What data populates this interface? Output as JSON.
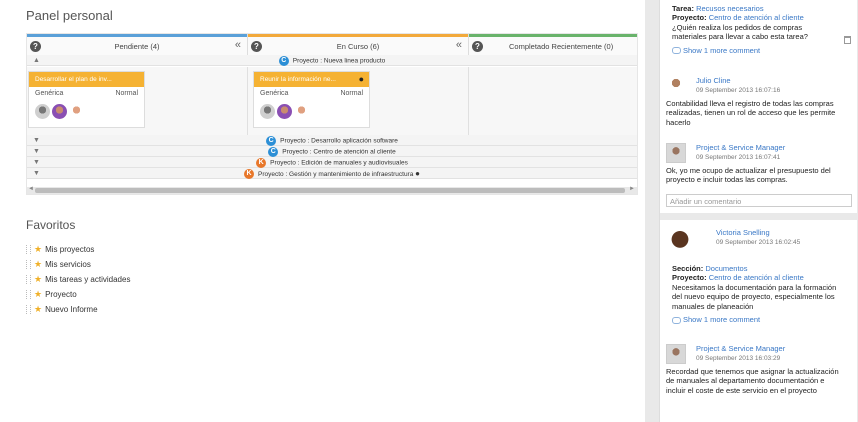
{
  "panel": {
    "title": "Panel personal"
  },
  "columns": [
    {
      "label": "Pendiente (4)",
      "color": "#5aa0d8",
      "collapse": "«"
    },
    {
      "label": "En Curso (6)",
      "color": "#f2a93b",
      "collapse": "«"
    },
    {
      "label": "Completado Recientemente (0)",
      "color": "#69b36b"
    }
  ],
  "lanes": [
    {
      "name": "Proyecto : Nueva linea producto",
      "badge": "C",
      "badge_color": "#2c8fd6",
      "expanded": true
    },
    {
      "name": "Proyecto : Desarrollo aplicación software",
      "badge": "C",
      "badge_color": "#2c8fd6"
    },
    {
      "name": "Proyecto : Centro de atención al cliente",
      "badge": "C",
      "badge_color": "#2c8fd6"
    },
    {
      "name": "Proyecto : Edición de manuales y audiovisuales",
      "badge": "K",
      "badge_color": "#e8772a"
    },
    {
      "name": "Proyecto : Gestión y mantenimiento de infraestructura",
      "badge": "K",
      "badge_color": "#e8772a"
    }
  ],
  "cards": [
    {
      "title": "Desarrollar el plan de inv...",
      "type": "Genérica",
      "priority": "Normal"
    },
    {
      "title": "Reunir la información ne...",
      "type": "Genérica",
      "priority": "Normal"
    }
  ],
  "favorites": {
    "title": "Favoritos",
    "items": [
      "Mis proyectos",
      "Mis servicios",
      "Mis tareas y actividades",
      "Proyecto",
      "Nuevo Informe"
    ]
  },
  "feed": {
    "top": {
      "tarea_label": "Tarea:",
      "tarea_value": "Recusos necesarios",
      "proyecto_label": "Proyecto:",
      "proyecto_value": "Centro de atención al cliente",
      "text": "¿Quién realiza los pedidos de compras materiales para llevar a cabo esta tarea?",
      "more": "Show 1 more comment"
    },
    "c1": {
      "user": "Julio Cline",
      "time": "09 September 2013 16:07:16",
      "text": "Contabilidad lleva el registro de todas las compras realizadas, tienen un rol de acceso que les permite hacerlo"
    },
    "c2": {
      "user": "Project & Service Manager",
      "time": "09 September 2013 16:07:41",
      "text": "Ok, yo me ocupo de actualizar el presupuesto del proyecto e incluir todas las compras."
    },
    "comment_placeholder": "Añadir un comentario",
    "post2": {
      "user": "Victoria Snelling",
      "time": "09 September 2013 16:02:45",
      "seccion_label": "Sección:",
      "seccion_value": "Documentos",
      "proyecto_label": "Proyecto:",
      "proyecto_value": "Centro de atención al cliente",
      "text": "Necesitamos la documentación para la formación del nuevo equipo de proyecto, especialmente los manuales de planeación",
      "more": "Show 1 more comment"
    },
    "c3": {
      "user": "Project & Service Manager",
      "time": "09 September 2013 16:03:29",
      "text": "Recordad que tenemos que asignar la actualización de manuales al departamento documentación e incluir el coste de este servicio en el proyecto"
    }
  }
}
